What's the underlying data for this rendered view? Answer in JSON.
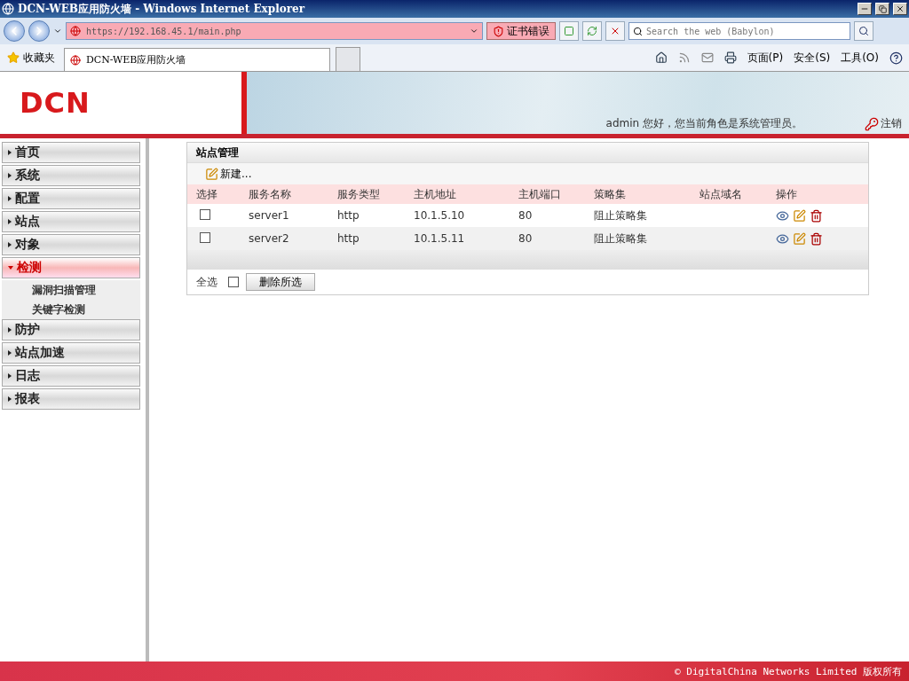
{
  "window": {
    "title": "DCN-WEB应用防火墙 - Windows Internet Explorer"
  },
  "address_bar": {
    "url": "https://192.168.45.1/main.php",
    "cert_error": "证书错误"
  },
  "search": {
    "placeholder": "Search the web (Babylon)"
  },
  "favorites": {
    "label": "收藏夹"
  },
  "tabs": [
    {
      "label": "DCN-WEB应用防火墙",
      "selected": true
    }
  ],
  "command_bar": [
    {
      "label": "页面(P)"
    },
    {
      "label": "安全(S)"
    },
    {
      "label": "工具(O)"
    }
  ],
  "header": {
    "logo": "DCN",
    "greeting": "admin 您好，您当前角色是系统管理员。",
    "logout": "注销"
  },
  "sidebar": {
    "items": [
      {
        "label": "首页",
        "expanded": false
      },
      {
        "label": "系统",
        "expanded": false
      },
      {
        "label": "配置",
        "expanded": false
      },
      {
        "label": "站点",
        "expanded": false
      },
      {
        "label": "对象",
        "expanded": false
      },
      {
        "label": "检测",
        "expanded": true,
        "children": [
          {
            "label": "漏洞扫描管理"
          },
          {
            "label": "关键字检测"
          }
        ]
      },
      {
        "label": "防护",
        "expanded": false
      },
      {
        "label": "站点加速",
        "expanded": false
      },
      {
        "label": "日志",
        "expanded": false
      },
      {
        "label": "报表",
        "expanded": false
      }
    ]
  },
  "panel": {
    "title": "站点管理",
    "new_button": "新建...",
    "columns": [
      "选择",
      "服务名称",
      "服务类型",
      "主机地址",
      "主机端口",
      "策略集",
      "站点域名",
      "操作"
    ],
    "rows": [
      {
        "checked": false,
        "cells": [
          "",
          "server1",
          "http",
          "10.1.5.10",
          "80",
          "阻止策略集",
          ""
        ]
      },
      {
        "checked": false,
        "cells": [
          "",
          "server2",
          "http",
          "10.1.5.11",
          "80",
          "阻止策略集",
          ""
        ]
      }
    ],
    "select_all": {
      "label": "全选",
      "checked": false
    },
    "delete_button": "删除所选"
  },
  "footer": "© DigitalChina Networks Limited 版权所有"
}
